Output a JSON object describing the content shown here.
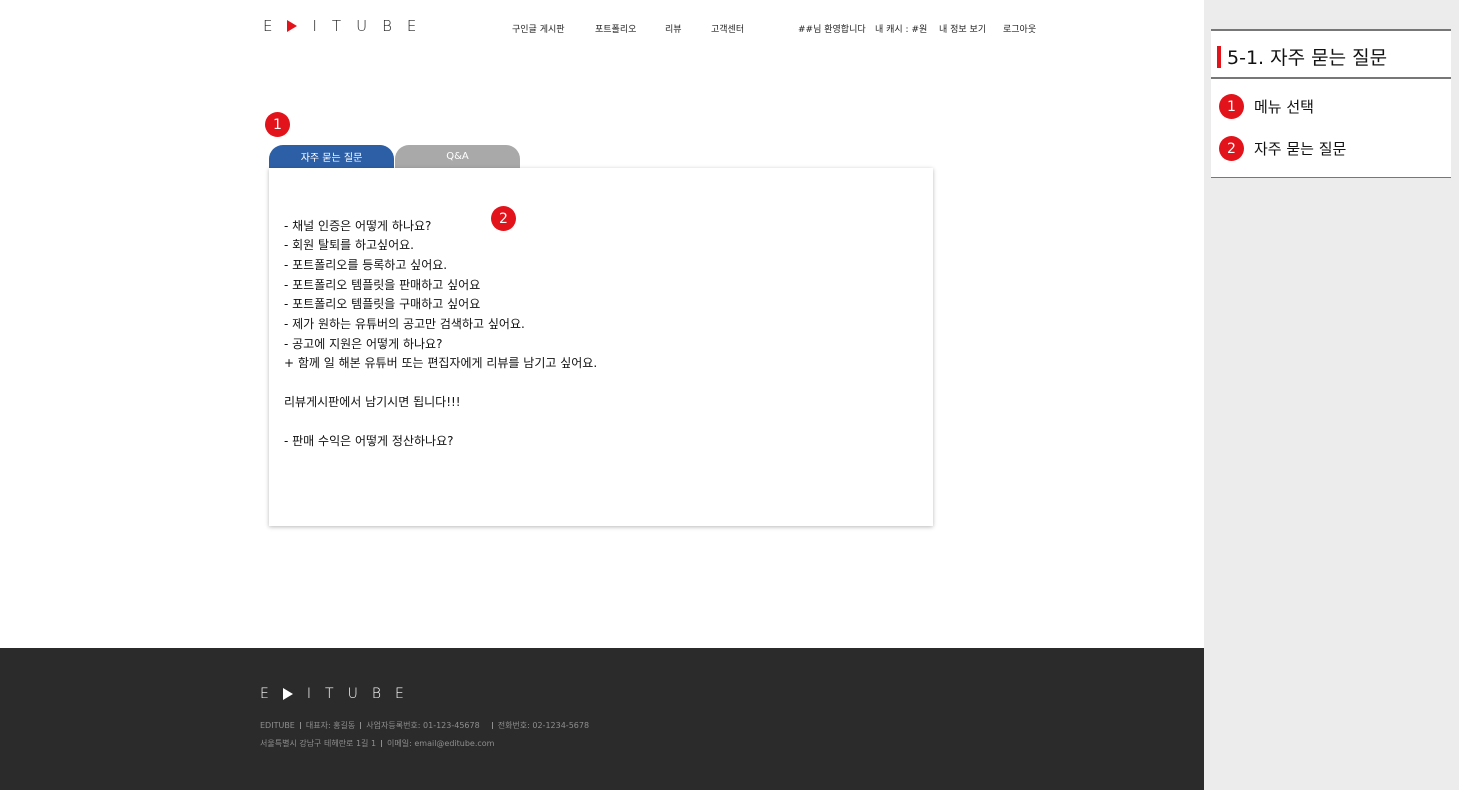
{
  "header": {
    "logo": [
      "E",
      "I",
      "T",
      "U",
      "B",
      "E"
    ],
    "nav": [
      "구인글 게시판",
      "포트폴리오",
      "리뷰",
      "고객센터"
    ],
    "welcome": "##님 환영합니다",
    "cash": "내 캐시 : #원",
    "my_info": "내 정보 보기",
    "logout": "로그아웃"
  },
  "markers": {
    "m1": "1",
    "m2": "2"
  },
  "tabs": {
    "faq": "자주 묻는 질문",
    "qna": "Q&A"
  },
  "faq": [
    "- 채널 인증은 어떻게 하나요?",
    "- 회원 탈퇴를 하고싶어요.",
    "- 포트폴리오를 등록하고 싶어요.",
    "- 포트폴리오 템플릿을 판매하고 싶어요",
    "- 포트폴리오 템플릿을 구매하고 싶어요",
    "- 제가 원하는 유튜버의 공고만 검색하고 싶어요.",
    "- 공고에 지원은 어떻게 하나요?",
    "+ 함께 일 해본 유튜버 또는 편집자에게 리뷰를 남기고 싶어요.",
    "리뷰게시판에서 남기시면 됩니다!!!",
    "- 판매 수익은 어떻게 정산하나요?"
  ],
  "footer": {
    "company": "EDITUBE",
    "ceo": "대표자: 홍길동",
    "biz_no": "사업자등록번호: 01-123-45678",
    "phone": "전화번호: 02-1234-5678",
    "address": "서울특별시 강남구 테헤란로 1길 1",
    "email": "이메일: email@editube.com"
  },
  "side": {
    "title": "5-1. 자주 묻는 질문",
    "items": [
      {
        "num": "1",
        "label": "메뉴 선택"
      },
      {
        "num": "2",
        "label": "자주 묻는 질문"
      }
    ]
  },
  "colors": {
    "accent": "#e3131b",
    "tab_active": "#2d5fa6",
    "tab_inactive": "#a9a9a9",
    "footer_bg": "#2b2b2b",
    "side_bg": "#ececec"
  }
}
